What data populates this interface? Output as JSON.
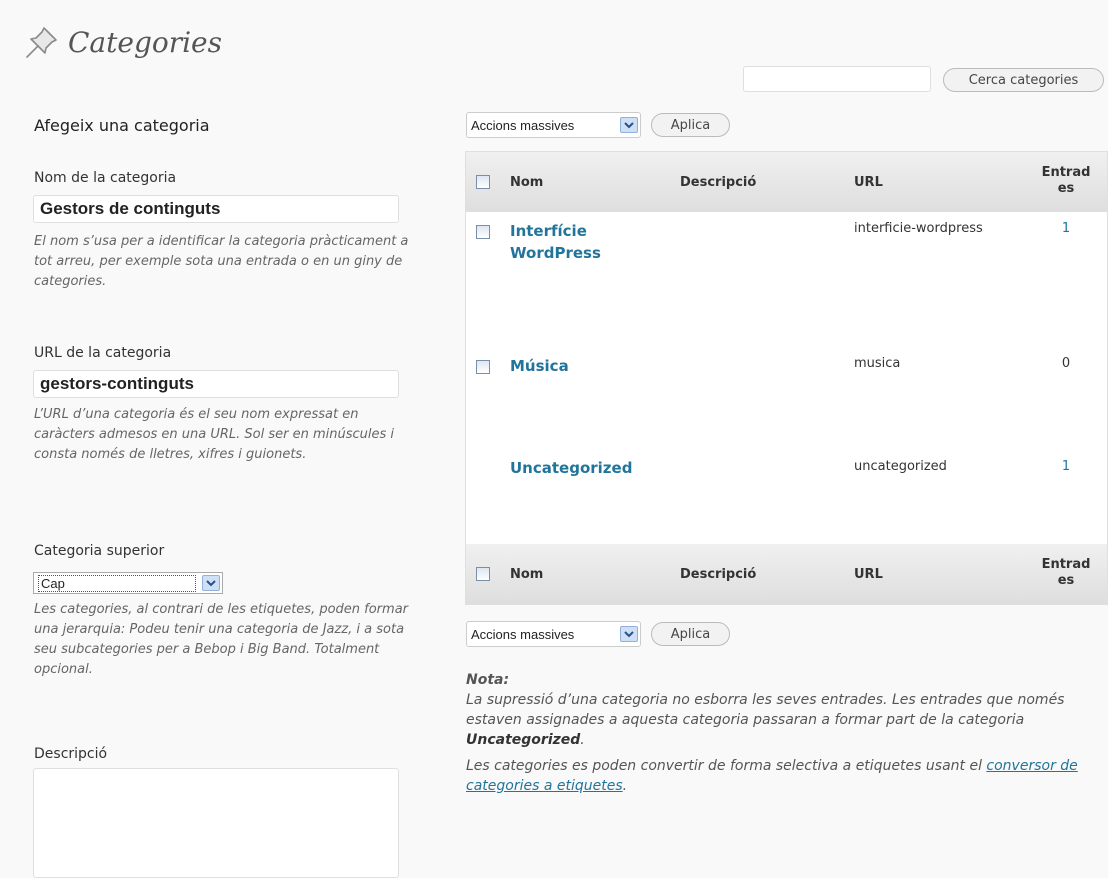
{
  "page": {
    "title": "Categories",
    "icon": "pushpin-icon"
  },
  "search": {
    "value": "",
    "button_label": "Cerca categories"
  },
  "add_form": {
    "heading": "Afegeix una categoria",
    "name": {
      "label": "Nom de la categoria",
      "value": "Gestors de continguts",
      "help": "El nom s’usa per a identificar la categoria pràcticament a tot arreu, per exemple sota una entrada o en un giny de categories."
    },
    "slug": {
      "label": "URL de la categoria",
      "value": "gestors-continguts",
      "help": "L’URL d’una categoria és el seu nom expressat en caràcters admesos en una URL. Sol ser en minúscules i consta només de lletres, xifres i guionets."
    },
    "parent": {
      "label": "Categoria superior",
      "selected": "Cap",
      "help": "Les categories, al contrari de les etiquetes, poden formar una jerarquia: Podeu tenir una categoria de Jazz, i a sota seu subcategories per a Bebop i Big Band. Totalment opcional."
    },
    "description": {
      "label": "Descripció",
      "value": ""
    }
  },
  "bulk": {
    "selected": "Accions massives",
    "apply_label": "Aplica"
  },
  "table": {
    "columns": {
      "name": "Nom",
      "description": "Descripció",
      "url": "URL",
      "count_line1": "Entrad",
      "count_line2": "es"
    },
    "rows": [
      {
        "name_line1": "Interfície",
        "name_line2": "WordPress",
        "description": "",
        "slug": "interficie-wordpress",
        "count": "1"
      },
      {
        "name_line1": "Música",
        "name_line2": "",
        "description": "",
        "slug": "musica",
        "count": "0"
      },
      {
        "name_line1": "Uncategorized",
        "name_line2": "",
        "description": "",
        "slug": "uncategorized",
        "count": "1"
      }
    ]
  },
  "note": {
    "label": "Nota:",
    "p1_text": "La supressió d’una categoria no esborra les seves entrades. Les entrades que només estaven assignades a aquesta categoria passaran a formar part de la categoria ",
    "p1_bold": "Uncategorized",
    "p1_end": ".",
    "p2_text": "Les categories es poden convertir de forma selectiva a etiquetes usant el ",
    "p2_link": "conversor de categories a etiquetes",
    "p2_end": "."
  },
  "colors": {
    "link": "#21759b",
    "header_bg": "#dfdfdf",
    "page_bg": "#f9f9f9"
  }
}
